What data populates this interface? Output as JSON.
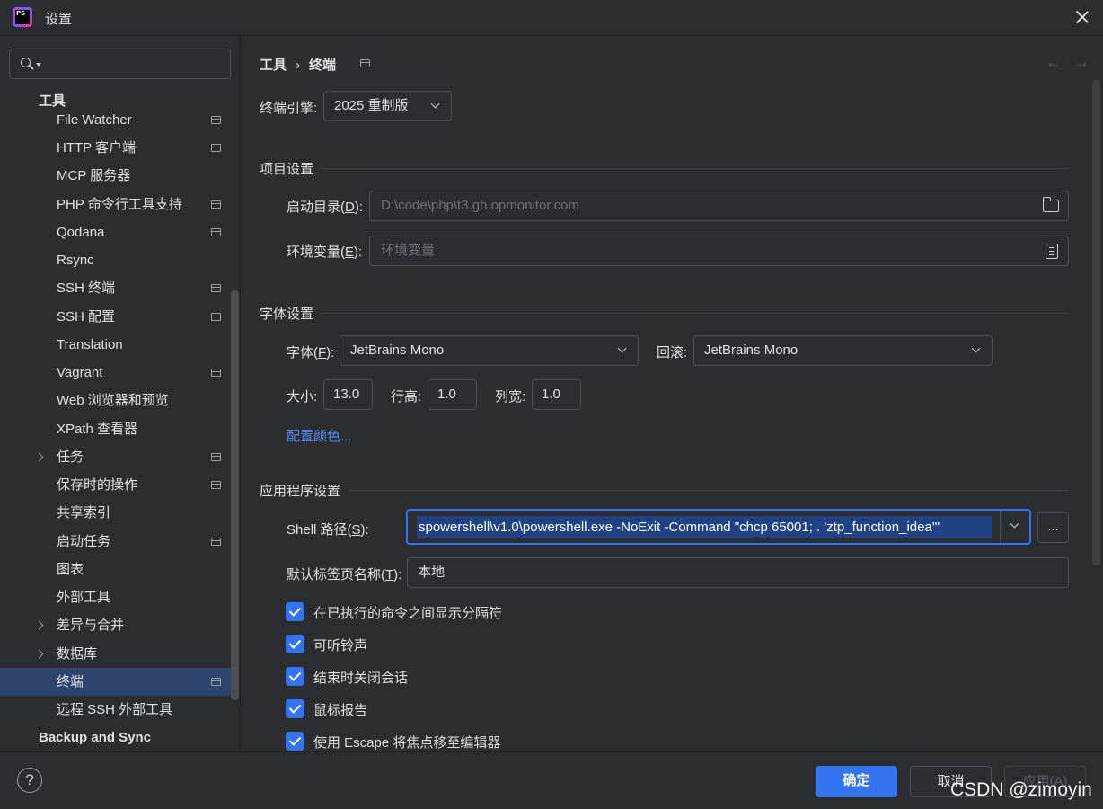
{
  "window": {
    "title": "设置",
    "app_icon_text": "PS"
  },
  "sidebar": {
    "search_placeholder": "",
    "group_tools": "工具",
    "items": [
      {
        "label": "File Watcher",
        "icon": true
      },
      {
        "label": "HTTP 客户端",
        "icon": true
      },
      {
        "label": "MCP 服务器",
        "icon": false
      },
      {
        "label": "PHP 命令行工具支持",
        "icon": true
      },
      {
        "label": "Qodana",
        "icon": true
      },
      {
        "label": "Rsync",
        "icon": false
      },
      {
        "label": "SSH 终端",
        "icon": true
      },
      {
        "label": "SSH 配置",
        "icon": true
      },
      {
        "label": "Translation",
        "icon": false
      },
      {
        "label": "Vagrant",
        "icon": true
      },
      {
        "label": "Web 浏览器和预览",
        "icon": false
      },
      {
        "label": "XPath 查看器",
        "icon": false
      },
      {
        "label": "任务",
        "icon": true,
        "expandable": true
      },
      {
        "label": "保存时的操作",
        "icon": true
      },
      {
        "label": "共享索引",
        "icon": false
      },
      {
        "label": "启动任务",
        "icon": true
      },
      {
        "label": "图表",
        "icon": false
      },
      {
        "label": "外部工具",
        "icon": false
      },
      {
        "label": "差异与合并",
        "icon": false,
        "expandable": true
      },
      {
        "label": "数据库",
        "icon": false,
        "expandable": true
      },
      {
        "label": "终端",
        "icon": true,
        "selected": true
      },
      {
        "label": "远程 SSH 外部工具",
        "icon": false
      }
    ],
    "group_backup": "Backup and Sync"
  },
  "main": {
    "breadcrumb": {
      "parent": "工具",
      "separator": "›",
      "current": "终端"
    },
    "engine": {
      "label": "终端引擎:",
      "value": "2025 重制版"
    },
    "project_section": {
      "title": "项目设置",
      "start_dir_label_pre": "启动目录(",
      "start_dir_mnemonic": "D",
      "start_dir_label_post": "):",
      "start_dir_value": "D:\\code\\php\\t3.gh.opmonitor.com",
      "env_label_pre": "环境变量(",
      "env_mnemonic": "E",
      "env_label_post": "):",
      "env_placeholder": "环境变量"
    },
    "font_section": {
      "title": "字体设置",
      "font_label_pre": "字体(",
      "font_mnemonic": "F",
      "font_label_post": "):",
      "font_value": "JetBrains Mono",
      "fallback_label": "回滚:",
      "fallback_value": "JetBrains Mono",
      "size_label": "大小:",
      "size_value": "13.0",
      "line_height_label": "行高:",
      "line_height_value": "1.0",
      "col_width_label": "列宽:",
      "col_width_value": "1.0",
      "color_link": "配置颜色..."
    },
    "app_section": {
      "title": "应用程序设置",
      "shell_label_pre": "Shell 路径(",
      "shell_mnemonic": "S",
      "shell_label_post": "):",
      "shell_value": "spowershell\\v1.0\\powershell.exe  -NoExit -Command \"chcp 65001; . 'ztp_function_idea'\"",
      "browse_label": "...",
      "tab_name_label_pre": "默认标签页名称(",
      "tab_name_mnemonic": "T",
      "tab_name_label_post": "):",
      "tab_name_value": "本地",
      "checkboxes": [
        {
          "label": "在已执行的命令之间显示分隔符",
          "checked": true
        },
        {
          "label": "可听铃声",
          "checked": true
        },
        {
          "label": "结束时关闭会话",
          "checked": true
        },
        {
          "label": "鼠标报告",
          "checked": true
        },
        {
          "label": "使用 Escape 将焦点移至编辑器",
          "checked": true
        }
      ]
    }
  },
  "footer": {
    "help": "?",
    "ok": "确定",
    "cancel": "取消",
    "apply": "应用(A)",
    "watermark": "CSDN @zimoyin"
  },
  "colors": {
    "accent": "#3574f0",
    "background": "#2b2d30",
    "selection": "#2e436e",
    "link": "#548af7"
  }
}
